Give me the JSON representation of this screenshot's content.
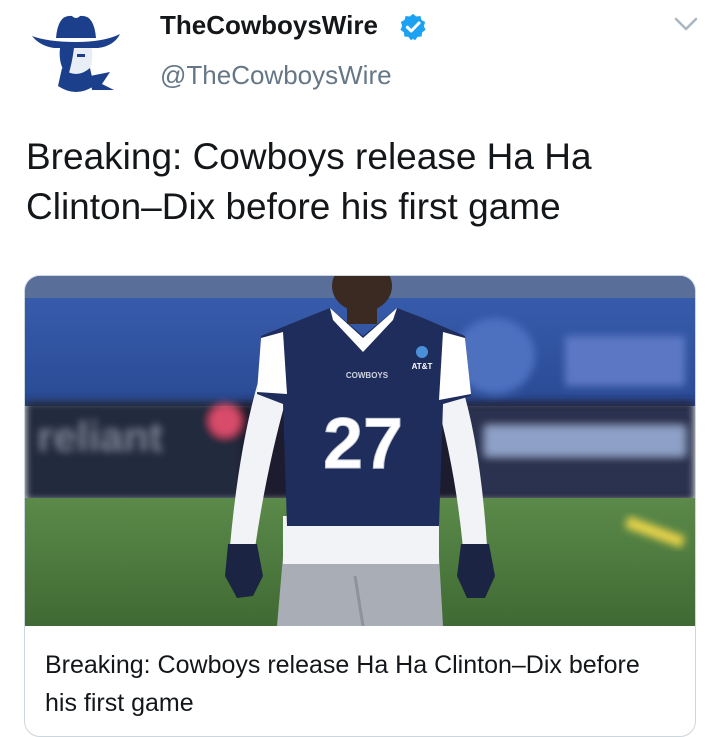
{
  "tweet": {
    "display_name": "TheCowboysWire",
    "handle": "@TheCowboysWire",
    "verified": true,
    "text": "Breaking: Cowboys release Ha Ha Clinton–Dix before his first game"
  },
  "card": {
    "title": "Breaking: Cowboys release Ha Ha Clinton–Dix before his first game",
    "image_text": {
      "jersey_number": "27",
      "sponsor": "AT&T",
      "chest_text": "COWBOYS",
      "banner_text": "reliant"
    }
  },
  "icons": {
    "avatar": "cowboy-logo-icon",
    "verified": "verified-badge-icon",
    "menu": "chevron-down-icon"
  },
  "colors": {
    "verified_blue": "#1da1f2",
    "logo_navy": "#1b3f8b",
    "jersey_navy": "#1f2d5c",
    "field_green": "#4d7a3f"
  }
}
